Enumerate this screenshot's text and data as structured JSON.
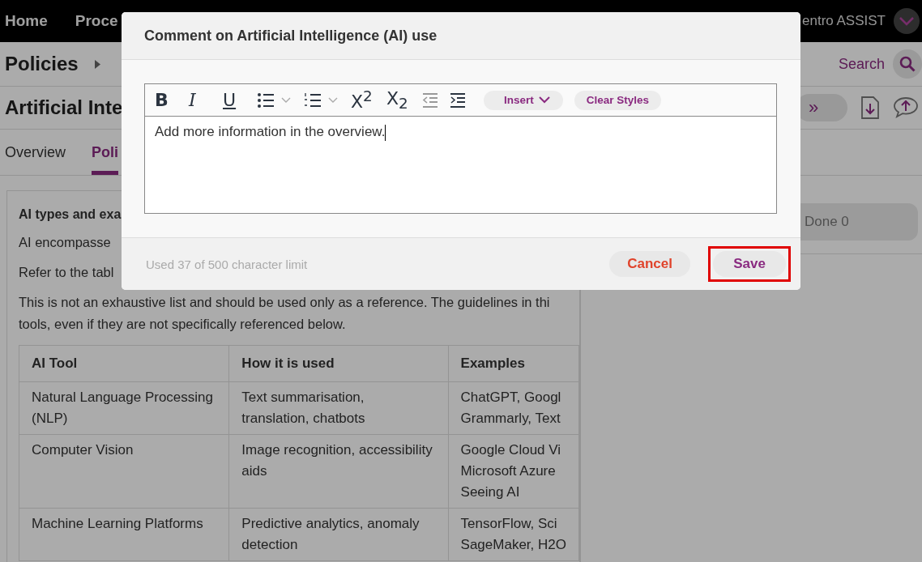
{
  "nav": {
    "items": [
      {
        "label": "Home"
      },
      {
        "label": "Proce"
      }
    ],
    "user": "entro ASSIST"
  },
  "breadcrumb": {
    "title": "Policies"
  },
  "search": {
    "label": "Search"
  },
  "document": {
    "title": "Artificial Inte",
    "next_button": "»"
  },
  "tabs": [
    {
      "label": "Overview",
      "selected": false
    },
    {
      "label": "Poli",
      "selected": true
    }
  ],
  "content": {
    "heading": "AI types and exa",
    "paragraphs": [
      [
        "AI encompasse"
      ],
      [
        "Refer to the tabl"
      ],
      [
        "This is not an exhaustive list and should be used only as a reference. The guidelines in thi",
        "tools, even if they are not specifically referenced below."
      ]
    ]
  },
  "table": {
    "columns": [
      "AI Tool",
      "How it is used",
      "Examples"
    ],
    "rows": [
      [
        "Natural Language Processing\n(NLP)",
        "Text summarisation,\ntranslation, chatbots",
        "ChatGPT, Googl\nGrammarly, Text"
      ],
      [
        "Computer Vision",
        "Image recognition, accessibility\naids",
        "Google Cloud Vi\nMicrosoft Azure\nSeeing AI"
      ],
      [
        "Machine Learning Platforms",
        "Predictive analytics, anomaly\ndetection",
        "TensorFlow, Sci\nSageMaker, H2O"
      ]
    ]
  },
  "side_panel": {
    "done": "Done 0"
  },
  "dialog": {
    "title": "Comment on Artificial Intelligence (AI) use",
    "toolbar": [
      {
        "kind": "bold",
        "label": "B"
      },
      {
        "kind": "italic",
        "label": "I"
      },
      {
        "kind": "underline",
        "label": "U"
      },
      {
        "kind": "bullets"
      },
      {
        "kind": "numbers"
      },
      {
        "kind": "superscript",
        "label": "X$^{2}$"
      },
      {
        "kind": "subscript",
        "label": "X$_{2}$"
      },
      {
        "kind": "outdent"
      },
      {
        "kind": "indent"
      },
      {
        "kind": "menu",
        "label": "Insert"
      },
      {
        "kind": "action",
        "label": "Clear Styles"
      }
    ],
    "value": "Add more information in the overview.",
    "counter": "Used 37 of 500 character limit",
    "buttons": [
      {
        "kind": "cancel",
        "label": "Cancel",
        "highlighted": false
      },
      {
        "kind": "save",
        "label": "Save",
        "highlighted": true
      }
    ]
  }
}
